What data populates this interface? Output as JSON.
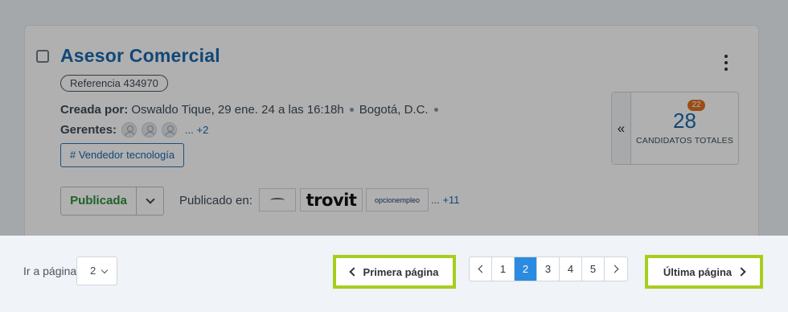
{
  "job": {
    "title": "Asesor Comercial",
    "reference": "Referencia 434970",
    "created_label": "Creada por:",
    "created_by": "Oswaldo Tique,",
    "created_date": "29 ene. 24 a las 16:18h",
    "location": "Bogotá, D.C.",
    "managers_label": "Gerentes:",
    "managers_more": "... +2",
    "tag": "# Vendedor tecnología",
    "status": "Publicada",
    "published_label": "Publicado en:",
    "portals": [
      "",
      "trovit",
      "opcionempleo"
    ],
    "portals_more": "... +11"
  },
  "candidates": {
    "toggle": "«",
    "new_badge": "22",
    "total": "28",
    "label": "CANDIDATOS TOTALES"
  },
  "pagination": {
    "goto_label": "Ir a página",
    "goto_value": "2",
    "first_label": "Primera página",
    "last_label": "Última página",
    "pages": [
      "1",
      "2",
      "3",
      "4",
      "5"
    ],
    "current": "2"
  },
  "colors": {
    "highlight": "#a6ce1b",
    "active_page": "#2a8be0",
    "title": "#1a67ad",
    "status_green": "#2f8f3a",
    "badge": "#e0701f"
  }
}
